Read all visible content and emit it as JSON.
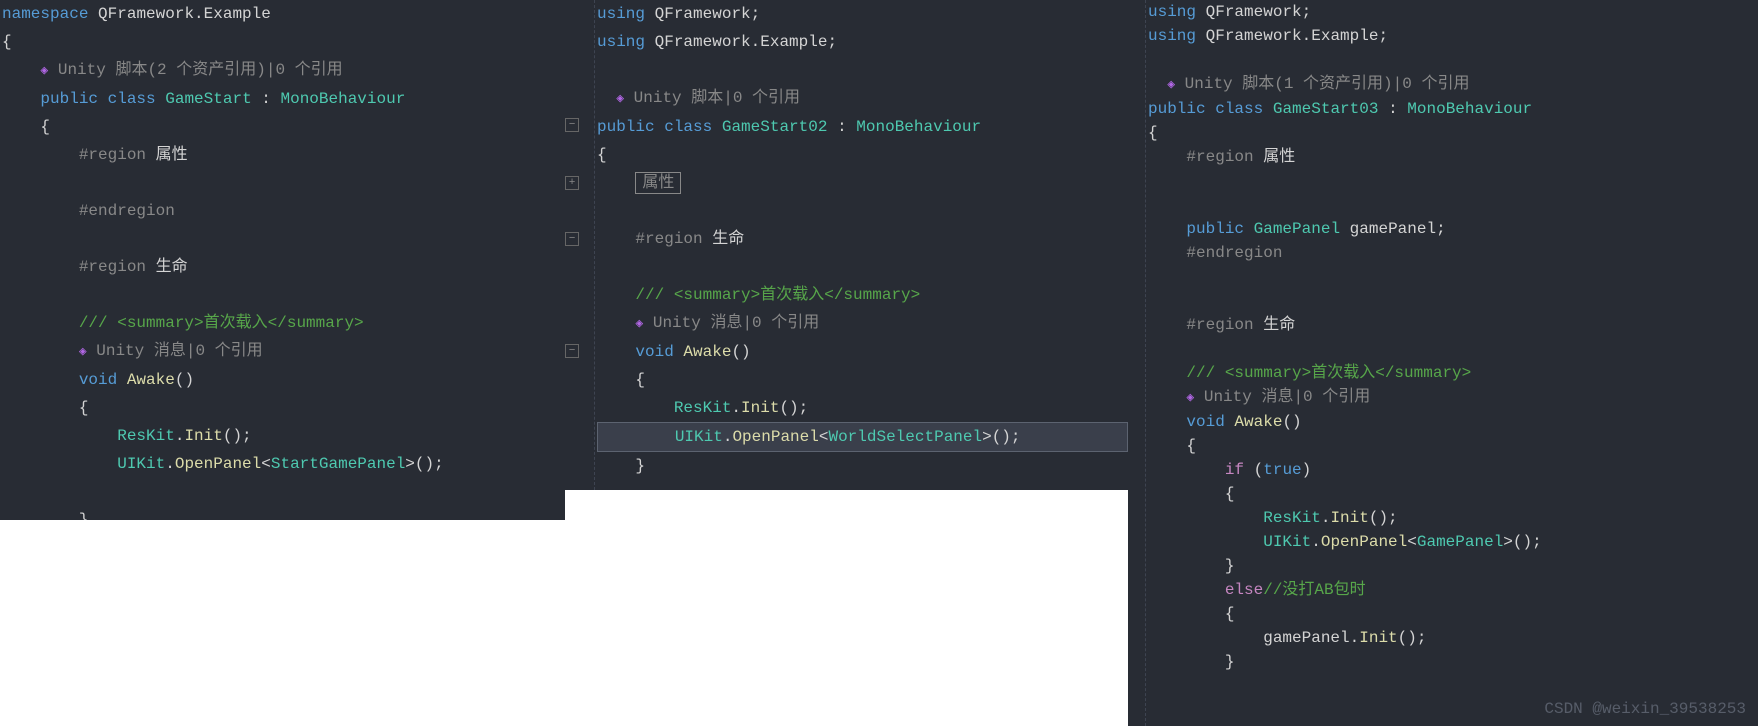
{
  "pane1": {
    "ns": "namespace",
    "ns_name": "QFramework.Example",
    "open_brace": "{",
    "codelens1": "Unity 脚本(2 个资产引用)|0 个引用",
    "pub": "public",
    "cls": "class",
    "cls_name": "GameStart",
    "colon": " : ",
    "base": "MonoBehaviour",
    "region1": "#region",
    "region1_name": "属性",
    "endregion1": "#endregion",
    "region2": "#region",
    "region2_name": "生命",
    "summary": "/// <summary>首次载入</summary>",
    "codelens2": "Unity 消息|0 个引用",
    "void": "void",
    "awake": "Awake",
    "reskit": "ResKit",
    "init": "Init",
    "uikit": "UIKit",
    "openpanel": "OpenPanel",
    "panel": "StartGamePanel"
  },
  "pane2": {
    "using1": "using",
    "using1_ns": "QFramework",
    "using2": "using",
    "using2_ns": "QFramework.Example",
    "codelens1": "Unity 脚本|0 个引用",
    "pub": "public",
    "cls": "class",
    "cls_name": "GameStart02",
    "colon": " : ",
    "base": "MonoBehaviour",
    "region_fold": "属性",
    "region2": "#region",
    "region2_name": "生命",
    "summary": "/// <summary>首次载入</summary>",
    "codelens2": "Unity 消息|0 个引用",
    "void": "void",
    "awake": "Awake",
    "reskit": "ResKit",
    "init": "Init",
    "uikit": "UIKit",
    "openpanel": "OpenPanel",
    "panel": "WorldSelectPanel"
  },
  "pane3": {
    "using1": "using",
    "using1_ns": "QFramework",
    "using2": "using",
    "using2_ns": "QFramework.Example",
    "codelens1": "Unity 脚本(1 个资产引用)|0 个引用",
    "pub": "public",
    "cls": "class",
    "cls_name": "GameStart03",
    "colon": " : ",
    "base": "MonoBehaviour",
    "region1": "#region",
    "region1_name": "属性",
    "pub_field": "public",
    "field_type": "GamePanel",
    "field_name": "gamePanel",
    "endregion1": "#endregion",
    "region2": "#region",
    "region2_name": "生命",
    "summary": "/// <summary>首次载入</summary>",
    "codelens2": "Unity 消息|0 个引用",
    "void": "void",
    "awake": "Awake",
    "if_kw": "if",
    "true_kw": "true",
    "reskit": "ResKit",
    "init": "Init",
    "uikit": "UIKit",
    "openpanel": "OpenPanel",
    "panel": "GamePanel",
    "else_kw": "else",
    "else_comment": "//没打AB包时",
    "gp_call": "gamePanel",
    "gp_method": "Init",
    "watermark": "CSDN @weixin_39538253"
  }
}
